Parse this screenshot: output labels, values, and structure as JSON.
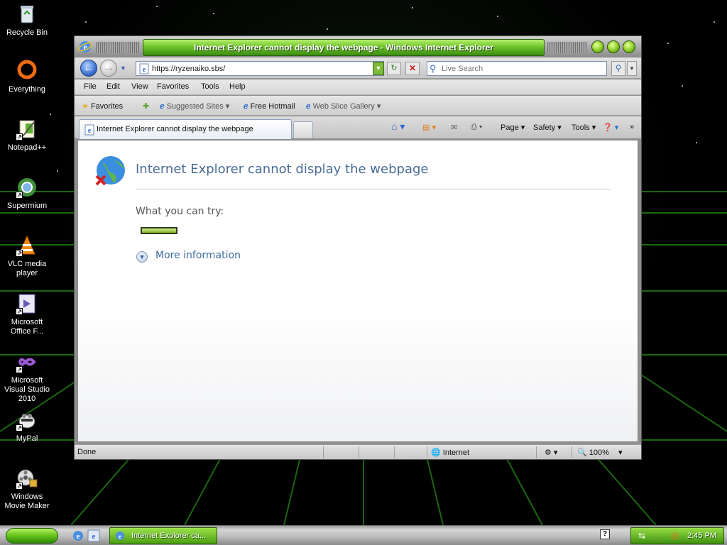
{
  "desktop": {
    "icons": [
      {
        "label": "Recycle Bin",
        "icon": "recycle-bin-icon"
      },
      {
        "label": "Everything",
        "icon": "everything-icon"
      },
      {
        "label": "Notepad++",
        "icon": "notepad-plus-plus-icon"
      },
      {
        "label": "Supermium",
        "icon": "supermium-icon"
      },
      {
        "label": "VLC media player",
        "icon": "vlc-icon"
      },
      {
        "label": "Microsoft Office F...",
        "icon": "office-icon"
      },
      {
        "label": "Microsoft Visual Studio 2010",
        "icon": "visual-studio-icon"
      },
      {
        "label": "MyPal",
        "icon": "mypal-icon"
      },
      {
        "label": "Windows Movie Maker",
        "icon": "movie-maker-icon"
      }
    ]
  },
  "window": {
    "title": "Internet Explorer cannot display the webpage - Windows Internet Explorer"
  },
  "navbar": {
    "address": "https://ryzenaiko.sbs/",
    "search_placeholder": "Live Search"
  },
  "menubar": [
    "File",
    "Edit",
    "View",
    "Favorites",
    "Tools",
    "Help"
  ],
  "favbar": {
    "favorites": "Favorites",
    "suggested": "Suggested Sites",
    "hotmail": "Free Hotmail",
    "webslice": "Web Slice Gallery"
  },
  "tab": {
    "label": "Internet Explorer cannot display the webpage"
  },
  "commandbar": {
    "page": "Page",
    "safety": "Safety",
    "tools": "Tools",
    "more": "»"
  },
  "error_page": {
    "title": "Internet Explorer cannot display the webpage",
    "what_to_try": "What you can try:",
    "more_info": "More information"
  },
  "statusbar": {
    "status": "Done",
    "zone": "Internet",
    "zoom": "100%"
  },
  "taskbar": {
    "task_label": "Internet Explorer ca...",
    "clock": "2:45 PM"
  },
  "colors": {
    "accent_green": "#6ec42a",
    "error_title": "#4a6c96",
    "link_blue": "#3d6a9e"
  }
}
